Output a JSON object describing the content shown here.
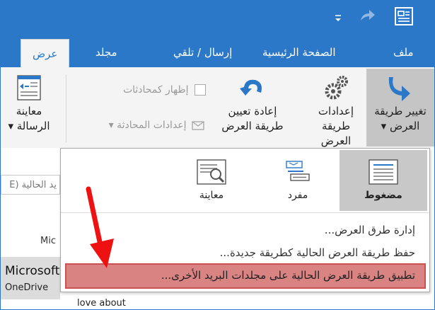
{
  "colors": {
    "accent": "#2b78c8",
    "highlight": "#d98383",
    "arrow": "#ee1111"
  },
  "titlebar": {
    "app_icon": "outlook-view-icon",
    "redo_icon": "redo-icon",
    "dropdown_icon": "customize-qat-icon"
  },
  "tabs": [
    {
      "label": "ملف"
    },
    {
      "label": "الصفحة الرئيسية"
    },
    {
      "label": "إرسال / تلقي"
    },
    {
      "label": "مجلد"
    },
    {
      "label": "عرض",
      "active": true
    }
  ],
  "ribbon": {
    "change_view": {
      "line1": "تغيير طريقة",
      "line2": "العرض ▾"
    },
    "view_settings": {
      "line1": "إعدادات",
      "line2": "طريقة العرض"
    },
    "reset_view": {
      "line1": "إعادة تعيين",
      "line2": "طريقة العرض"
    },
    "show_conversations": "إظهار كمحادثات",
    "conversation_settings": "إعدادات المحادثة ▾",
    "message_preview": {
      "line1": "معاينة",
      "line2": "الرسالة ▾"
    }
  },
  "left_pane": {
    "search_placeholder": "يد الحالية (E",
    "mic_label": "Mic",
    "account_name": "Microsoft",
    "account_sub": "OneDrive",
    "message_snippet": "love about"
  },
  "menu": {
    "views": [
      {
        "label": "مضغوط",
        "icon": "compact-view-icon",
        "selected": true
      },
      {
        "label": "مفرد",
        "icon": "single-view-icon"
      },
      {
        "label": "معاينة",
        "icon": "preview-view-icon"
      }
    ],
    "manage_views": "إدارة طرق العرض...",
    "save_view_as": "حفظ طريقة العرض الحالية كطريقة جديدة...",
    "apply_view": "تطبيق طريقة العرض الحالية على مجلدات البريد الأخرى..."
  }
}
